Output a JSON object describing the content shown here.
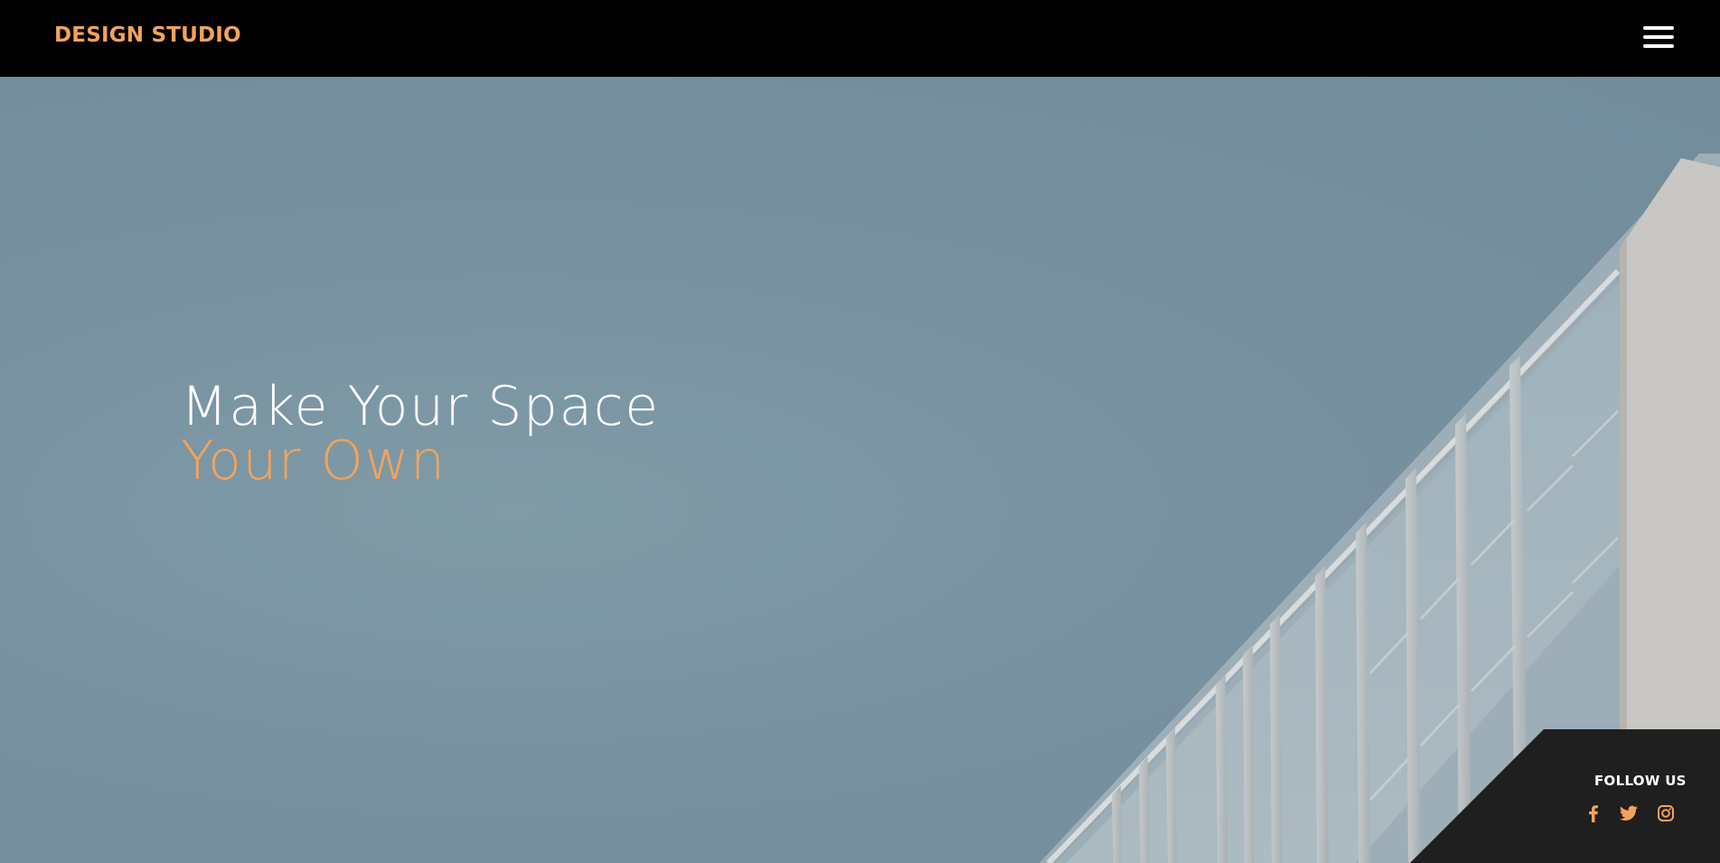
{
  "header": {
    "brand": "DESIGN STUDIO",
    "menu_icon": "hamburger-menu-icon"
  },
  "hero": {
    "headline_line1": "Make Your Space",
    "headline_line2": "Your Own",
    "background": "building-facade-against-sky"
  },
  "follow": {
    "title": "FOLLOW US",
    "links": [
      {
        "icon": "facebook-icon"
      },
      {
        "icon": "twitter-icon"
      },
      {
        "icon": "instagram-icon"
      }
    ]
  },
  "colors": {
    "accent": "#f3a35c",
    "navbar": "#000000",
    "panel": "#1f1f1f",
    "sky": "#7b95a1"
  }
}
